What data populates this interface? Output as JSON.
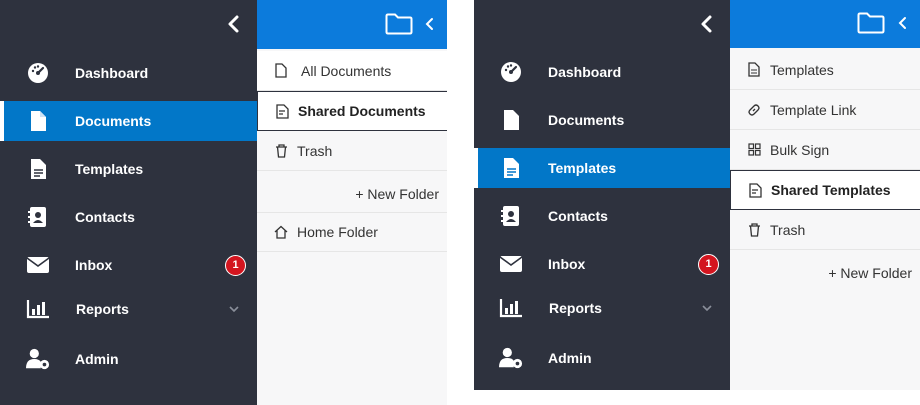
{
  "colors": {
    "sidebar_bg": "#2e323e",
    "active_bg": "#0277c8",
    "panel_header": "#0c7bdc",
    "badge": "#d3151f"
  },
  "left": {
    "sidebar": {
      "items": [
        {
          "label": "Dashboard",
          "icon": "dashboard-icon"
        },
        {
          "label": "Documents",
          "icon": "document-icon",
          "active": true
        },
        {
          "label": "Templates",
          "icon": "template-icon"
        },
        {
          "label": "Contacts",
          "icon": "contacts-icon"
        },
        {
          "label": "Inbox",
          "icon": "envelope-icon",
          "badge": "1"
        },
        {
          "label": "Reports",
          "icon": "bar-chart-icon"
        },
        {
          "label": "Admin",
          "icon": "admin-icon"
        }
      ]
    },
    "panel": {
      "items": [
        {
          "label": "All Documents",
          "icon": "file-icon"
        },
        {
          "label": "Shared Documents",
          "icon": "shared-doc-icon",
          "selected": true
        },
        {
          "label": "Trash",
          "icon": "trash-icon"
        }
      ],
      "new_folder": "+ New Folder",
      "home_folder": "Home Folder"
    }
  },
  "right": {
    "sidebar": {
      "items": [
        {
          "label": "Dashboard",
          "icon": "dashboard-icon"
        },
        {
          "label": "Documents",
          "icon": "document-icon"
        },
        {
          "label": "Templates",
          "icon": "template-icon",
          "active": true
        },
        {
          "label": "Contacts",
          "icon": "contacts-icon"
        },
        {
          "label": "Inbox",
          "icon": "envelope-icon",
          "badge": "1"
        },
        {
          "label": "Reports",
          "icon": "bar-chart-icon"
        },
        {
          "label": "Admin",
          "icon": "admin-icon"
        }
      ]
    },
    "panel": {
      "items": [
        {
          "label": "Templates",
          "icon": "template-file-icon"
        },
        {
          "label": "Template Link",
          "icon": "link-icon"
        },
        {
          "label": "Bulk Sign",
          "icon": "grid-icon"
        },
        {
          "label": "Shared Templates",
          "icon": "shared-doc-icon",
          "selected": true
        },
        {
          "label": "Trash",
          "icon": "trash-icon"
        }
      ],
      "new_folder": "+ New Folder"
    }
  }
}
